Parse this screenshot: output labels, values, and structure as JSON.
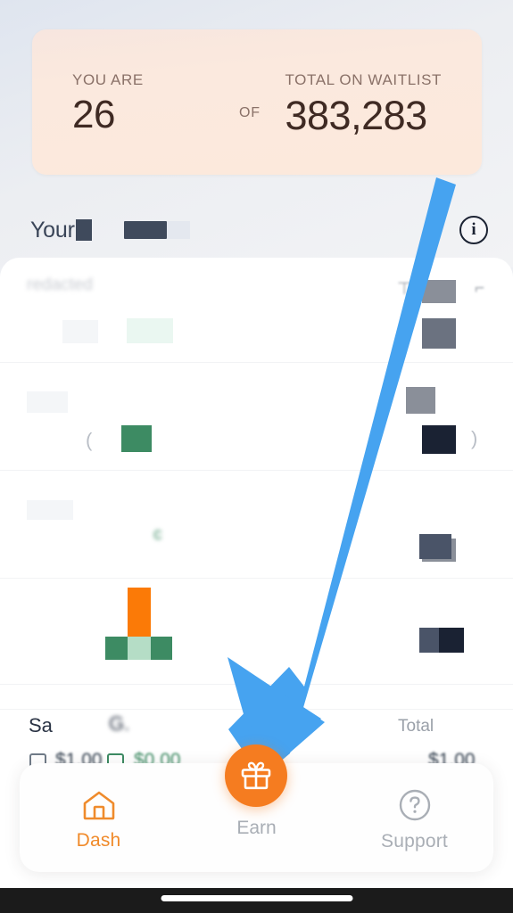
{
  "waitlist": {
    "you_are_label": "YOU ARE",
    "you_are_value": "26",
    "of_label": "OF",
    "total_label": "TOTAL ON WAITLIST",
    "total_value": "383,283",
    "card_color": "#fce9dc"
  },
  "header": {
    "title_prefix": "Your",
    "info_icon_glyph": "i"
  },
  "content": {
    "sales_label": "Sa",
    "total_label": "Total",
    "amount_left": "$1.00",
    "amount_middle": "$0.00",
    "amount_right": "$1.00",
    "obscured_note": "redacted"
  },
  "annotation": {
    "arrow_color": "#46a3f0",
    "points_to": "Earn"
  },
  "nav": {
    "items": [
      {
        "label": "Dash",
        "icon": "home-icon",
        "active": true
      },
      {
        "label": "Earn",
        "icon": "gift-icon",
        "active": false
      },
      {
        "label": "Support",
        "icon": "help-icon",
        "active": false
      }
    ],
    "accent_color": "#f57c20",
    "inactive_color": "#a9aeb5"
  }
}
